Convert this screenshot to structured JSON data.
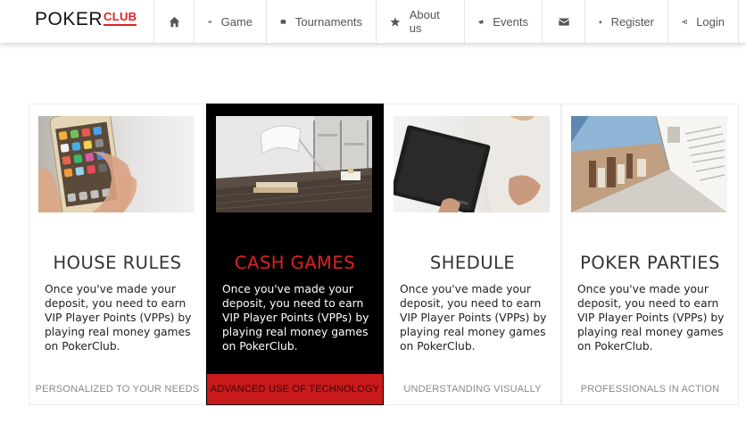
{
  "brand": {
    "name_main": "POKER",
    "name_accent": "CLUB"
  },
  "nav": {
    "items": [
      {
        "label": "",
        "icon": "home-icon"
      },
      {
        "label": "Game",
        "icon": "eye-icon"
      },
      {
        "label": "Tournaments",
        "icon": "briefcase-icon"
      },
      {
        "label": "About us",
        "icon": "star-icon"
      },
      {
        "label": "Events",
        "icon": "bullhorn-icon"
      },
      {
        "label": "",
        "icon": "envelope-icon"
      },
      {
        "label": "Register",
        "icon": "lock-icon"
      },
      {
        "label": "Login",
        "icon": "sign-in-icon"
      }
    ]
  },
  "colors": {
    "accent": "#e02121",
    "active_card_bg": "#000000",
    "active_footer_bg": "#c8191b"
  },
  "cards": [
    {
      "title": "HOUSE RULES",
      "description": "Once you've made your deposit, you need to earn VIP Player Points (VPPs) by playing real money games on PokerClub.",
      "footer": "PERSONALIZED TO YOUR NEEDS",
      "active": false
    },
    {
      "title": "CASH GAMES",
      "description": "Once you've made your deposit, you need to earn VIP Player Points (VPPs) by playing real money games on PokerClub.",
      "footer": "ADVANCED USE OF TECHNOLOGY",
      "active": true
    },
    {
      "title": "SHEDULE",
      "description": "Once you've made your deposit, you need to earn VIP Player Points (VPPs) by playing real money games on PokerClub.",
      "footer": "UNDERSTANDING VISUALLY",
      "active": false
    },
    {
      "title": "POKER PARTIES",
      "description": "Once you've made your deposit, you need to earn VIP Player Points (VPPs) by playing real money games on PokerClub.",
      "footer": "PROFESSIONALS IN ACTION",
      "active": false
    }
  ]
}
